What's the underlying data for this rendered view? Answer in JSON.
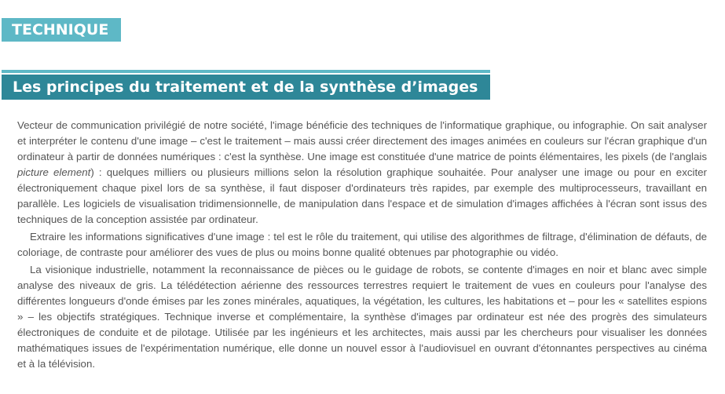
{
  "section_tag": "TECHNIQUE",
  "title": "Les principes du traitement et de la synthèse d’images",
  "paragraphs": [
    {
      "before": "Vecteur de communication privilégié de notre société, l'image bénéficie des techniques de l'informatique graphique, ou infographie. On sait analyser et interpréter le contenu d'une image – c'est le traitement – mais aussi créer directement des images animées en couleurs sur l'écran graphique d'un ordinateur à partir de données numériques : c'est la synthèse. Une image est constituée d'une matrice de points élémentaires, les pixels (de l'anglais ",
      "emphasis": "picture element",
      "after": ") : quelques milliers ou plusieurs millions selon la résolution graphique souhaitée. Pour analyser une image ou pour en exciter électroniquement chaque pixel lors de sa synthèse, il faut disposer d'ordinateurs très rapides, par exemple des multiprocesseurs, travaillant en parallèle. Les logiciels de visualisation tridimensionnelle, de manipulation dans l'espace et de simulation d'images affichées à l'écran sont issus des techniques de la conception assistée par ordinateur."
    },
    "Extraire les informations significatives d'une image : tel est le rôle du traitement, qui utilise des algorithmes de filtrage, d'élimination de défauts, de coloriage, de contraste pour améliorer des vues de plus ou moins bonne qualité obtenues par photographie ou vidéo.",
    "La visionique industrielle, notamment la reconnaissance de pièces ou le guidage de robots, se contente d'images en noir et blanc avec simple analyse des niveaux de gris. La télédétection aérienne des ressources terrestres requiert le traitement de vues en couleurs pour l'analyse des différentes longueurs d'onde émises par les zones minérales, aquatiques, la végétation, les cultures, les habitations et – pour les « satellites espions » – les objectifs stratégiques. Technique inverse et complémentaire, la synthèse d'images par ordinateur est née des progrès des simulateurs électroniques de conduite et de pilotage. Utilisée par les ingénieurs et les architectes, mais aussi par les chercheurs pour visualiser les données mathématiques issues de l'expérimentation numérique, elle donne un nouvel essor à l'audiovisuel en ouvrant d'étonnantes perspectives au cinéma et à la télévision."
  ],
  "colors": {
    "tag_background": "#5eb8c6",
    "title_background": "#2e8798",
    "heading_text": "#ffffff",
    "body_text": "#555555"
  }
}
